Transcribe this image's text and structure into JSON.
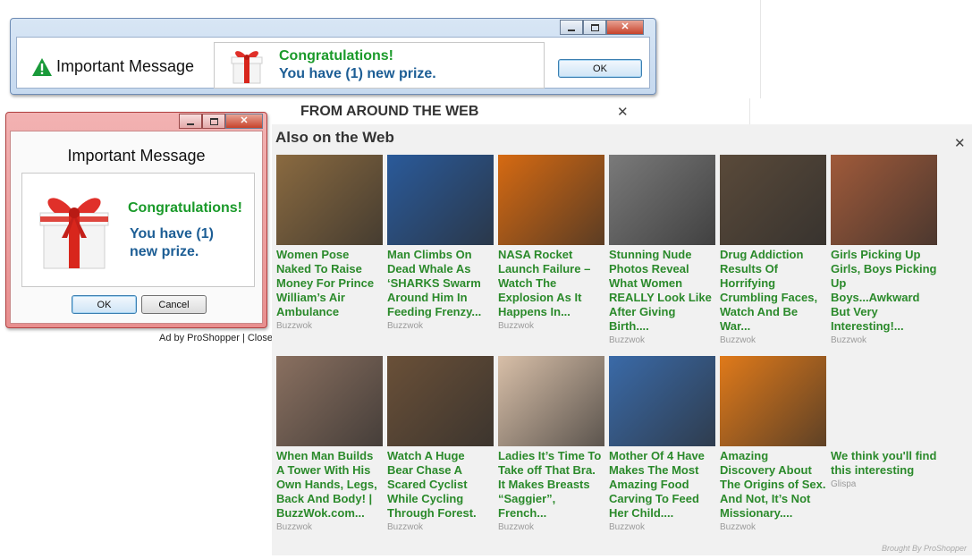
{
  "banner": {
    "title": "Important Message",
    "congrats": "Congratulations!",
    "prize": "You have (1) new prize.",
    "ok_label": "OK"
  },
  "dialog": {
    "title": "Important Message",
    "congrats": "Congratulations!",
    "prize": "You have (1) new prize.",
    "ok_label": "OK",
    "cancel_label": "Cancel",
    "ad_by": "Ad by ProShopper | Close"
  },
  "widget": {
    "from_label": "FROM AROUND THE WEB",
    "title": "Also on the Web",
    "brought_by": "Brought By ProShopper",
    "cards": [
      {
        "title": "Women Pose Naked To Raise Money For Prince William’s Air Ambulance",
        "source": "Buzzwok",
        "color": "#8a6a40"
      },
      {
        "title": "Man Climbs On Dead Whale As ‘SHARKS Swarm Around Him In Feeding Frenzy...",
        "source": "Buzzwok",
        "color": "#2a5a9a"
      },
      {
        "title": "NASA Rocket Launch Failure – Watch The Explosion As It Happens In...",
        "source": "Buzzwok",
        "color": "#d66a12"
      },
      {
        "title": "Stunning Nude Photos Reveal What Women REALLY Look Like After Giving Birth....",
        "source": "Buzzwok",
        "color": "#7a7a7a"
      },
      {
        "title": "Drug Addiction Results Of Horrifying Crumbling Faces, Watch And Be War...",
        "source": "Buzzwok",
        "color": "#5a4a3a"
      },
      {
        "title": "Girls Picking Up Girls, Boys Picking Up Boys...Awkward But Very Interesting!...",
        "source": "Buzzwok",
        "color": "#a05a3a"
      },
      {
        "title": "When Man Builds A Tower With His Own Hands, Legs, Back And Body! | BuzzWok.com...",
        "source": "Buzzwok",
        "color": "#8a7060"
      },
      {
        "title": "Watch A Huge Bear Chase A Scared Cyclist While Cycling Through Forest.",
        "source": "Buzzwok",
        "color": "#6a5038"
      },
      {
        "title": "Ladies It’s Time To Take off That Bra. It Makes Breasts “Saggier”, French...",
        "source": "Buzzwok",
        "color": "#d8bfa8"
      },
      {
        "title": "Mother Of 4 Have Makes The Most Amazing Food Carving To Feed Her Child....",
        "source": "Buzzwok",
        "color": "#3a6aa8"
      },
      {
        "title": "Amazing Discovery About The Origins of Sex. And Not, It’s Not Missionary....",
        "source": "Buzzwok",
        "color": "#e07a1a"
      },
      {
        "title": "We think you'll find this interesting",
        "source": "Glispa",
        "color": ""
      }
    ]
  }
}
